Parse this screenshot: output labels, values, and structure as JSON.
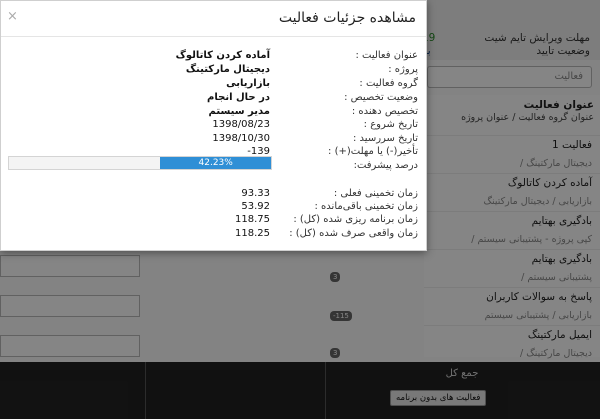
{
  "background": {
    "timesheet_label": "مهلت ویرایش تایم شیت",
    "approval_label": "وضعیت تایید",
    "timesheet_value": "19",
    "approval_value": "بر",
    "filter_placeholder": "فعالیت",
    "panel_title": "عنوان فعالیت",
    "panel_subtitle": "عنوان گروه فعالیت  /  عنوان پروژه",
    "activities": [
      {
        "name": "فعالیت 1",
        "group": "/ دیجیتال مارکتینگ"
      },
      {
        "name": "آماده کردن کاتالوگ",
        "group": "بازاریابی / دیجیتال مارکتینگ"
      },
      {
        "name": "بادگیری بهتایم",
        "group": "/ کپی پروژه - پشتیبانی سیستم"
      },
      {
        "name": "بادگیری بهتایم",
        "group": "/ پشتیبانی سیستم"
      },
      {
        "name": "پاسخ به سوالات کاربران",
        "group": "بازاریابی / پشتیبانی سیستم"
      },
      {
        "name": "ایمیل مارکتینگ",
        "group": "/ دیجیتال مارکتینگ"
      }
    ],
    "badges": [
      "3",
      "-115",
      "3"
    ],
    "footer_total": "جمع کل",
    "footer_button": "فعالیت های بدون برنامه"
  },
  "modal": {
    "title": "مشاهده جزئیات فعالیت",
    "close_icon": "×",
    "fields": [
      {
        "label": "عنوان فعالیت :",
        "value": "آماده کردن کاتالوگ"
      },
      {
        "label": "پروژه :",
        "value": "دیجیتال مارکتینگ"
      },
      {
        "label": "گروه فعالیت :",
        "value": "بازاریابی"
      },
      {
        "label": "وضعیت تخصیص :",
        "value": "در حال انجام"
      },
      {
        "label": "تخصیص دهنده :",
        "value": "مدیر سیستم"
      },
      {
        "label": "تاریخ شروع :",
        "value": "1398/08/23"
      },
      {
        "label": "تاریخ سررسید :",
        "value": "1398/10/30"
      },
      {
        "label": "تأخیر(-) یا مهلت(+) :",
        "value": "-139"
      }
    ],
    "progress": {
      "label": "درصد پیشرفت:",
      "value_text": "42.23%",
      "fraction": 0.4223,
      "color": "#2f8fd6"
    },
    "times": [
      {
        "label": "زمان تخمینی فعلی :",
        "value": "93.33"
      },
      {
        "label": "زمان تخمینی باقی‌مانده :",
        "value": "53.92"
      },
      {
        "label": "زمان برنامه ریزی شده (کل) :",
        "value": "118.75"
      },
      {
        "label": "زمان واقعی صرف شده (کل) :",
        "value": "118.25"
      }
    ]
  }
}
